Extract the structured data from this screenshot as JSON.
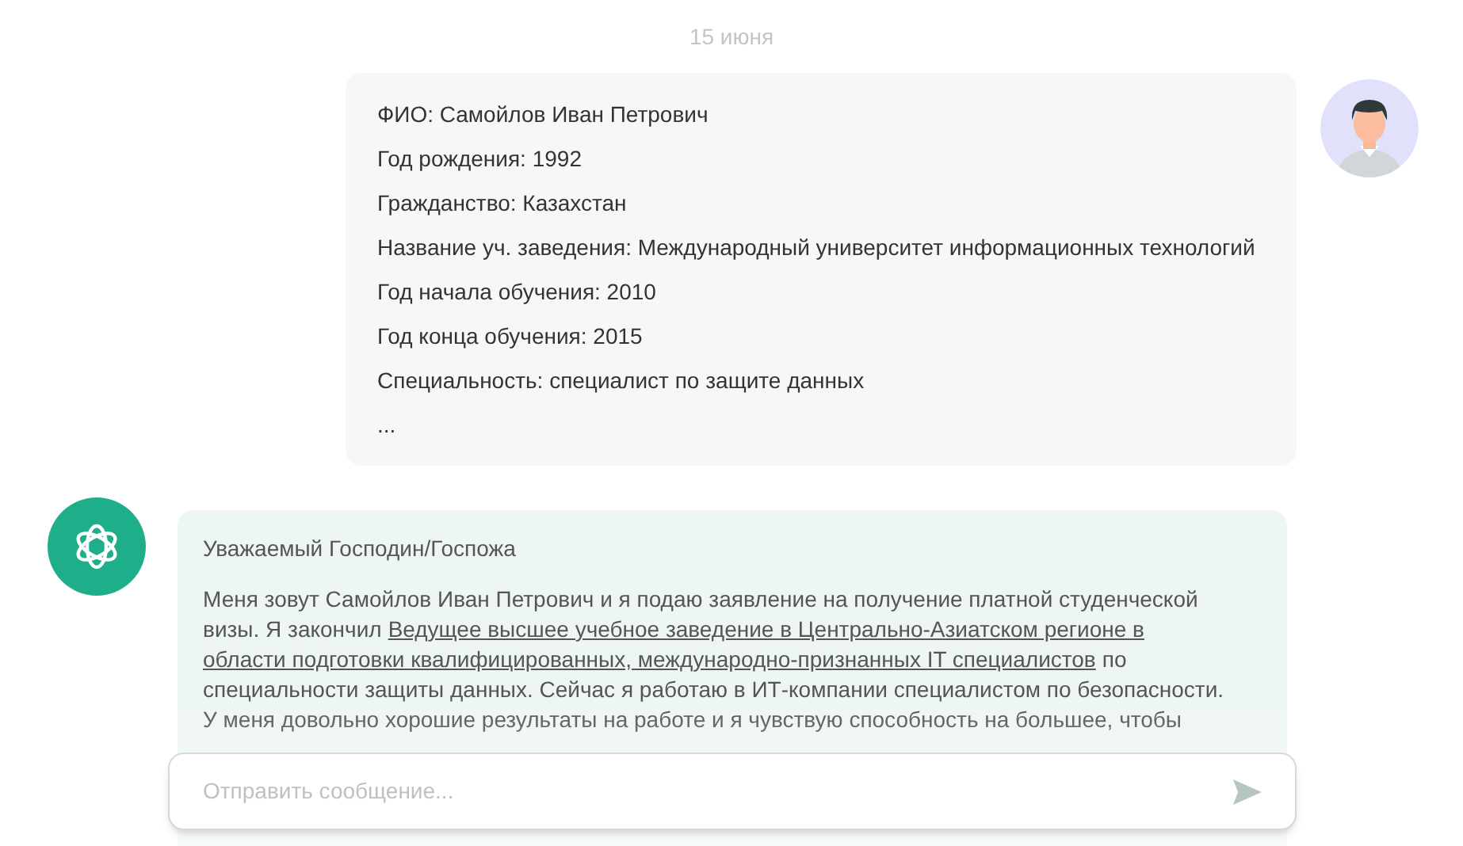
{
  "date": "15 июня",
  "user_message": {
    "lines": [
      "ФИО: Самойлов Иван Петрович",
      "Год рождения: 1992",
      "Гражданство: Казахстан",
      "Название уч. заведения: Международный университет информационных технологий",
      "Год начала обучения: 2010",
      "Год конца обучения: 2015",
      "Специальность: специалист по защите данных",
      "..."
    ]
  },
  "bot_message": {
    "greeting": "Уважаемый Господин/Госпожа",
    "paragraph_lines": [
      [
        {
          "text": "Меня зовут Самойлов Иван Петрович и я подаю заявление на получение платной студенческой",
          "kind": "text"
        }
      ],
      [
        {
          "text": "визы. Я закончил",
          "kind": "text"
        },
        {
          "text": "Ведущее высшее учебное заведение в Центрально-Азиатском регионе в",
          "kind": "link"
        }
      ],
      [
        {
          "text": "области подготовки квалифицированных, международно-признанных IT специалистов",
          "kind": "link"
        },
        {
          "text": "по",
          "kind": "text"
        }
      ],
      [
        {
          "text": "специальности защиты данных. Сейчас я работаю в ИТ-компании специалистом по безопасности.",
          "kind": "text"
        }
      ],
      [
        {
          "text": "У меня довольно хорошие результаты на работе и я чувствую способность на большее, чтобы",
          "kind": "text"
        }
      ]
    ]
  },
  "composer": {
    "placeholder": "Отправить сообщение..."
  }
}
